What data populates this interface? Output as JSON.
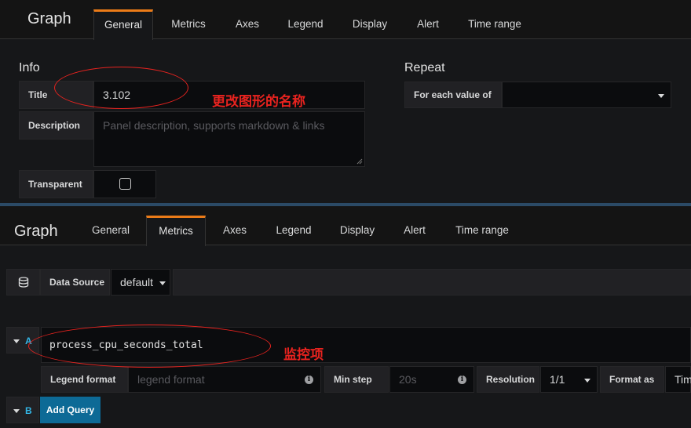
{
  "top": {
    "graph_title": "Graph",
    "tabs": [
      "General",
      "Metrics",
      "Axes",
      "Legend",
      "Display",
      "Alert",
      "Time range"
    ],
    "active_tab": "General",
    "info_heading": "Info",
    "title_label": "Title",
    "title_value": "3.102",
    "description_label": "Description",
    "description_placeholder": "Panel description, supports markdown & links",
    "transparent_label": "Transparent",
    "repeat_heading": "Repeat",
    "repeat_label": "For each value of",
    "annotation": "更改图形的名称"
  },
  "bottom": {
    "graph_title": "Graph",
    "tabs": [
      "General",
      "Metrics",
      "Axes",
      "Legend",
      "Display",
      "Alert",
      "Time range"
    ],
    "active_tab": "Metrics",
    "datasource_label": "Data Source",
    "datasource_value": "default",
    "query_a_letter": "A",
    "query_a_expr": "process_cpu_seconds_total",
    "annotation": "监控项",
    "legend_format_label": "Legend format",
    "legend_format_placeholder": "legend format",
    "min_step_label": "Min step",
    "min_step_placeholder": "20s",
    "resolution_label": "Resolution",
    "resolution_value": "1/1",
    "format_as_label": "Format as",
    "format_as_value": "Tim",
    "query_b_letter": "B",
    "add_query_label": "Add Query"
  },
  "colors": {
    "accent_tab": "#eb7b18",
    "annotation_red": "#e8231f",
    "query_letter": "#33b5e5",
    "add_query_bg": "#0d6a96"
  }
}
